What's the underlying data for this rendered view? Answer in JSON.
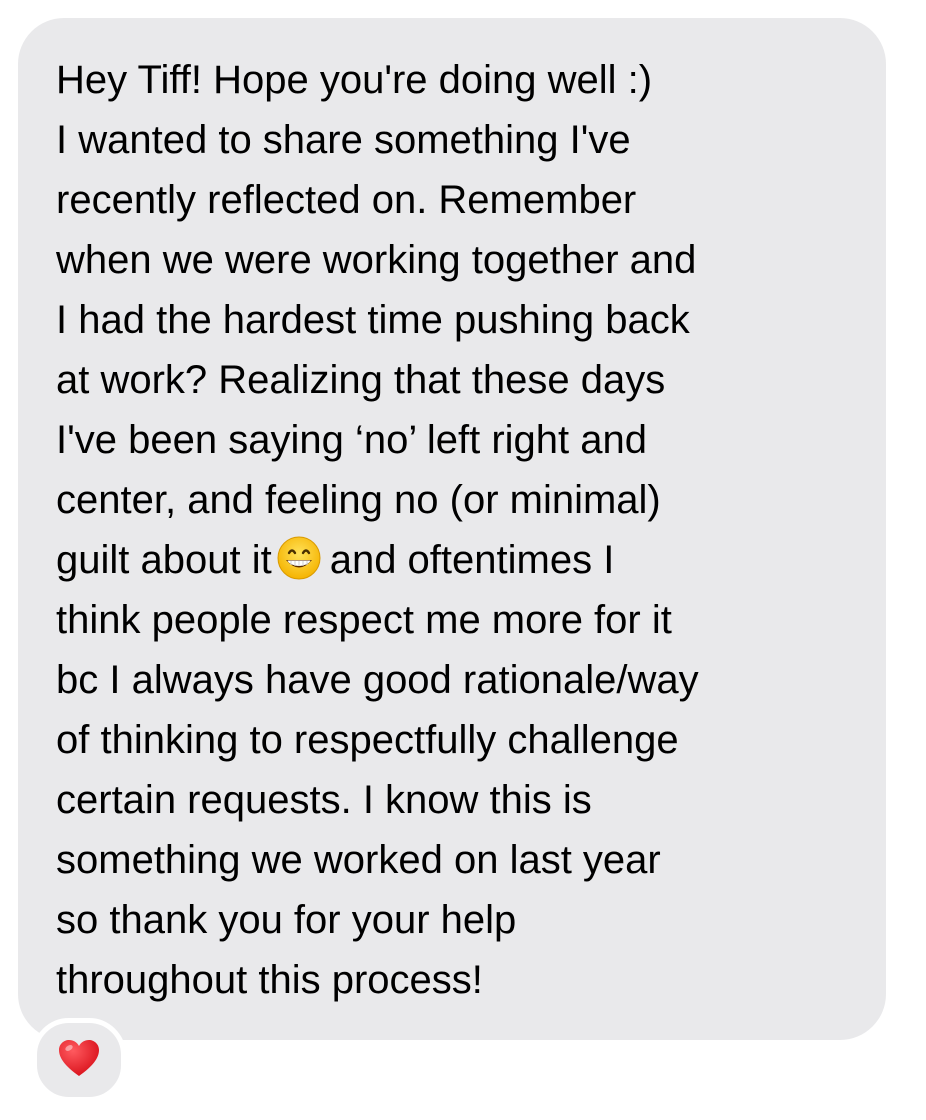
{
  "message": {
    "lines": [
      "Hey Tiff! Hope you're doing well :)",
      "I wanted to share something I've",
      "recently reflected on. Remember",
      "when we were working together and",
      "I had the hardest time pushing back",
      "at work? Realizing that these days",
      "I've been saying ‘no’ left right and",
      "center, and feeling no (or minimal)",
      "guilt about it",
      "and oftentimes I",
      "think people respect me more for it",
      "bc I always have good rationale/way",
      "of thinking to respectfully challenge",
      "certain requests. I know this is",
      "something we worked on last year",
      "so thank you for your help",
      "throughout this process!"
    ],
    "emoji": "grinning-face-with-smiling-eyes-icon",
    "bubble_color": "#e9e9eb",
    "text_color": "#000000"
  },
  "reaction": {
    "icon": "red-heart-icon",
    "color": "#e0181e"
  }
}
